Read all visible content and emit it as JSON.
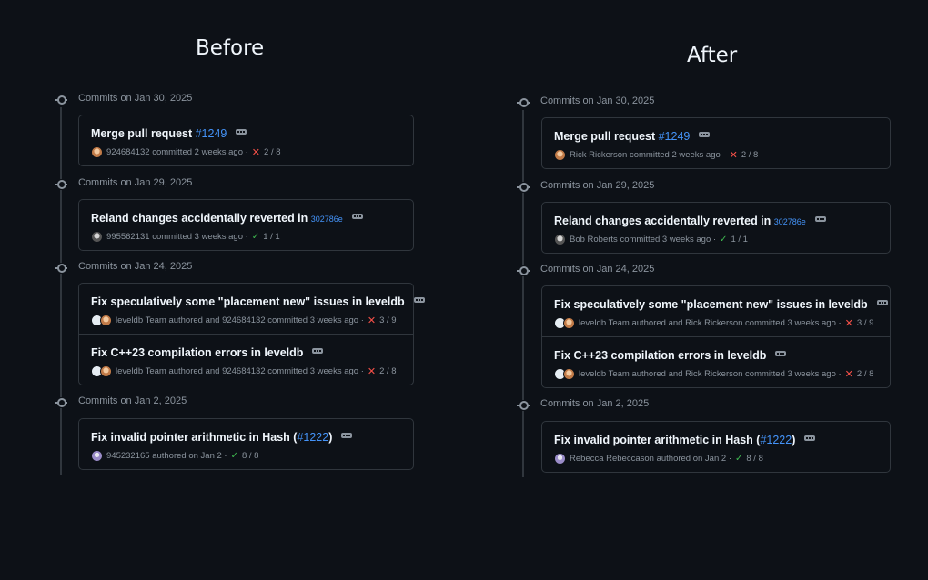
{
  "panels": [
    {
      "title": "Before",
      "groups": [
        {
          "date": "Commits on Jan 30, 2025",
          "commits": [
            {
              "title": "Merge pull request ",
              "link": "#1249",
              "suffix": "",
              "meta": "924684132 committed 2 weeks ago ·",
              "status": "fail",
              "checks": "2 / 8"
            }
          ]
        },
        {
          "date": "Commits on Jan 29, 2025",
          "commits": [
            {
              "title": "Reland changes accidentally reverted in ",
              "link": "302786e",
              "suffix": "",
              "meta": "995562131 committed 3 weeks ago ·",
              "status": "pass",
              "checks": "1 / 1"
            }
          ]
        },
        {
          "date": "Commits on Jan 24, 2025",
          "commits": [
            {
              "title": "Fix speculatively some \"placement new\" issues in leveldb",
              "link": "",
              "suffix": "",
              "meta": "leveldb Team authored and 924684132 committed 3 weeks ago ·",
              "status": "fail",
              "checks": "3 / 9"
            },
            {
              "title": "Fix C++23 compilation errors in leveldb",
              "link": "",
              "suffix": "",
              "meta": "leveldb Team authored and 924684132 committed 3 weeks ago ·",
              "status": "fail",
              "checks": "2 / 8"
            }
          ]
        },
        {
          "date": "Commits on Jan 2, 2025",
          "commits": [
            {
              "title": "Fix invalid pointer arithmetic in Hash (",
              "link": "#1222",
              "suffix": ")",
              "meta": "945232165 authored on Jan 2 ·",
              "status": "pass",
              "checks": "8 / 8"
            }
          ]
        }
      ]
    },
    {
      "title": "After",
      "groups": [
        {
          "date": "Commits on Jan 30, 2025",
          "commits": [
            {
              "title": "Merge pull request ",
              "link": "#1249",
              "suffix": "",
              "meta": "Rick Rickerson committed 2 weeks ago ·",
              "status": "fail",
              "checks": "2 / 8"
            }
          ]
        },
        {
          "date": "Commits on Jan 29, 2025",
          "commits": [
            {
              "title": "Reland changes accidentally reverted in ",
              "link": "302786e",
              "suffix": "",
              "meta": "Bob Roberts committed 3 weeks ago ·",
              "status": "pass",
              "checks": "1 / 1"
            }
          ]
        },
        {
          "date": "Commits on Jan 24, 2025",
          "commits": [
            {
              "title": "Fix speculatively some \"placement new\" issues in leveldb",
              "link": "",
              "suffix": "",
              "meta": "leveldb Team authored and Rick Rickerson committed 3 weeks ago ·",
              "status": "fail",
              "checks": "3 / 9"
            },
            {
              "title": "Fix C++23 compilation errors in leveldb",
              "link": "",
              "suffix": "",
              "meta": "leveldb Team authored and Rick Rickerson committed 3 weeks ago ·",
              "status": "fail",
              "checks": "2 / 8"
            }
          ]
        },
        {
          "date": "Commits on Jan 2, 2025",
          "commits": [
            {
              "title": "Fix invalid pointer arithmetic in Hash (",
              "link": "#1222",
              "suffix": ")",
              "meta": "Rebecca Rebeccason authored on Jan 2 ·",
              "status": "pass",
              "checks": "8 / 8"
            }
          ]
        }
      ]
    }
  ],
  "icons": {
    "commit": "git-commit-icon",
    "more": "ellipsis-icon",
    "fail": "x-icon",
    "pass": "check-icon"
  },
  "colors": {
    "background": "#0d1117",
    "link": "#4493f8",
    "fail": "#f85149",
    "pass": "#3fb950",
    "border": "#30363d",
    "muted": "#8b949e"
  }
}
